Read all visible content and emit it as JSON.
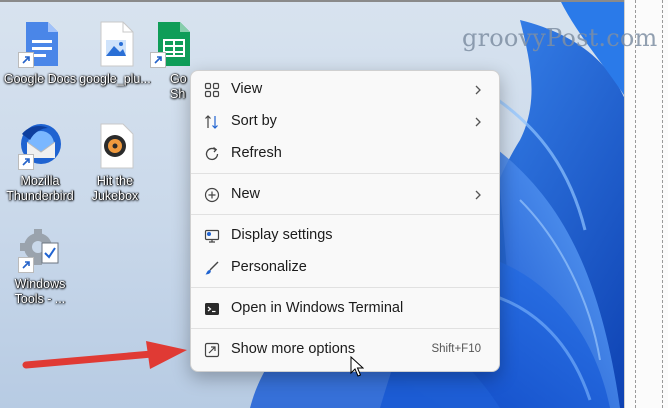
{
  "desktop": {
    "watermark": "groovyPost.com",
    "icons": [
      {
        "label": "Google Docs",
        "icon": "google-docs-icon"
      },
      {
        "label": "google_plu...",
        "icon": "image-file-icon"
      },
      {
        "label": "Go Sh",
        "icon": "google-sheets-icon"
      },
      {
        "label": "Mozilla Thunderbird",
        "icon": "thunderbird-icon"
      },
      {
        "label": "Hit the Jukebox",
        "icon": "jukebox-icon"
      },
      {
        "label": "Windows Tools - ...",
        "icon": "windows-tools-icon"
      }
    ]
  },
  "context_menu": {
    "items": [
      {
        "label": "View",
        "icon": "grid-icon",
        "submenu": true
      },
      {
        "label": "Sort by",
        "icon": "sort-icon",
        "submenu": true
      },
      {
        "label": "Refresh",
        "icon": "refresh-icon"
      },
      {
        "label": "New",
        "icon": "plus-circle-icon",
        "submenu": true
      },
      {
        "label": "Display settings",
        "icon": "display-icon"
      },
      {
        "label": "Personalize",
        "icon": "brush-icon"
      },
      {
        "label": "Open in Windows Terminal",
        "icon": "terminal-icon"
      },
      {
        "label": "Show more options",
        "icon": "expand-icon",
        "shortcut": "Shift+F10"
      }
    ]
  },
  "colors": {
    "menu_bg": "#f9f9f9",
    "arrow": "#e03a34",
    "bloom": "#1d63d8",
    "desktop_bg": "#d2deeb"
  }
}
